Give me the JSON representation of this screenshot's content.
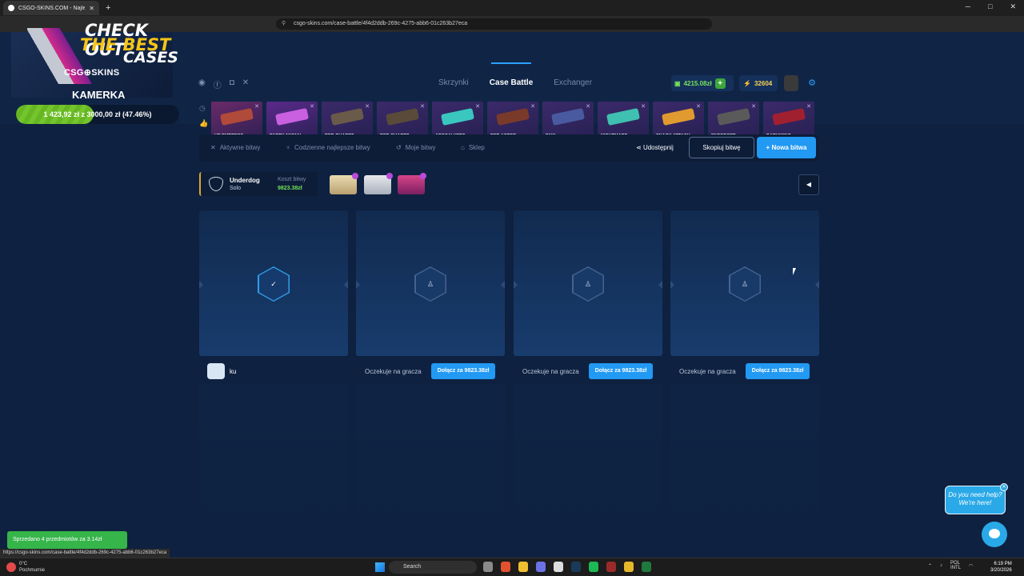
{
  "browser": {
    "tab_title": "CSGO-SKINS.COM - Najlepsze...",
    "new_tab": "+",
    "url": "csgo-skins.com/case-battle/4f4d2ddb-269c-4275-abb6-01c263b27eca",
    "status_url": "https://csgo-skins.com/case-battle/4f4d2ddb-269c-4275-abb6-01c263b27eca"
  },
  "promo": {
    "line1": "CHECK OUT",
    "line2": "THE BEST",
    "line3": "CASES",
    "logo": "CSG⊕SKINS",
    "stream_title": "KAMERKA",
    "goal_text": "1 423,92 zł z 3000,00 zł (47.46%)",
    "goal_fraction": 0.4746
  },
  "nav": {
    "items": [
      "Skrzynki",
      "Case Battle",
      "Exchanger"
    ],
    "active": "Case Battle"
  },
  "wallet": {
    "balance": "4215.08zł",
    "coins": "32604"
  },
  "drops": [
    {
      "name": "HE EMPRESS",
      "sub": "od zbudit",
      "color": "#6a2a6a",
      "gun": "#b04a3a"
    },
    {
      "name": "PARTY ANIMAL",
      "sub": "w tej chwili",
      "color": "#5a2a8a",
      "gun": "#c860e0"
    },
    {
      "name": "RED QUARTZ",
      "sub": "1 sekundę temu",
      "color": "#3b2a6a",
      "gun": "#6a5a4a"
    },
    {
      "name": "RED QUARTZ",
      "sub": "1 sekundę temu",
      "color": "#3b2a6a",
      "gun": "#5a4a3a"
    },
    {
      "name": "APOCALYPTO",
      "sub": "1 sekundę temu",
      "color": "#3b2a6a",
      "gun": "#39c7c0"
    },
    {
      "name": "RED ASTOR",
      "sub": "1 sekundę temu",
      "color": "#3b2a6a",
      "gun": "#7a3a2a"
    },
    {
      "name": "PAW",
      "sub": "1 sekundę temu",
      "color": "#3b2a6a",
      "gun": "#4a5aa0"
    },
    {
      "name": "NIGHTMARE",
      "sub": "2 sekundy temu",
      "color": "#3b2a6a",
      "gun": "#40c0b0"
    },
    {
      "name": "SNACK ATTACK",
      "sub": "2 sekundy temu",
      "color": "#3b2a6a",
      "gun": "#e09a30"
    },
    {
      "name": "ENFORCER",
      "sub": "3 sekundy temu",
      "color": "#3b2a6a",
      "gun": "#5a5a5a"
    },
    {
      "name": "DARKWING",
      "sub": "3 sekundy temu",
      "color": "#3b2a6a",
      "gun": "#a02030"
    }
  ],
  "toolbar": {
    "active_battles": "Aktywne bitwy",
    "daily_best": "Codzienne najlepsze bitwy",
    "my_battles": "Moje bitwy",
    "shop": "Sklep",
    "share": "Udostępnij",
    "copy": "Skopiuj bitwę",
    "new_battle": "+ Nowa bitwa"
  },
  "battle": {
    "mode": "Underdog",
    "type": "Solo",
    "cost_label": "Koszt bitwy",
    "cost": "9823.38zł"
  },
  "players": [
    {
      "name": "ku",
      "joined": true
    },
    {
      "waiting": "Oczekuje na gracza",
      "join": "Dołącz za 9823.38zł"
    },
    {
      "waiting": "Oczekuje na gracza",
      "join": "Dołącz za 9823.38zł"
    },
    {
      "waiting": "Oczekuje na gracza",
      "join": "Dołącz za 9823.38zł"
    }
  ],
  "toast": "Sprzedano 4 przedmiotów za 3.14zł",
  "help": {
    "line1": "Do you need help?",
    "line2": "We're here!"
  },
  "taskbar": {
    "weather_temp": "0°C",
    "weather_desc": "Pochmurnie",
    "search": "Search",
    "lang1": "POL",
    "lang2": "INTL",
    "time": "6:19 PM",
    "date": "3/20/2026"
  }
}
